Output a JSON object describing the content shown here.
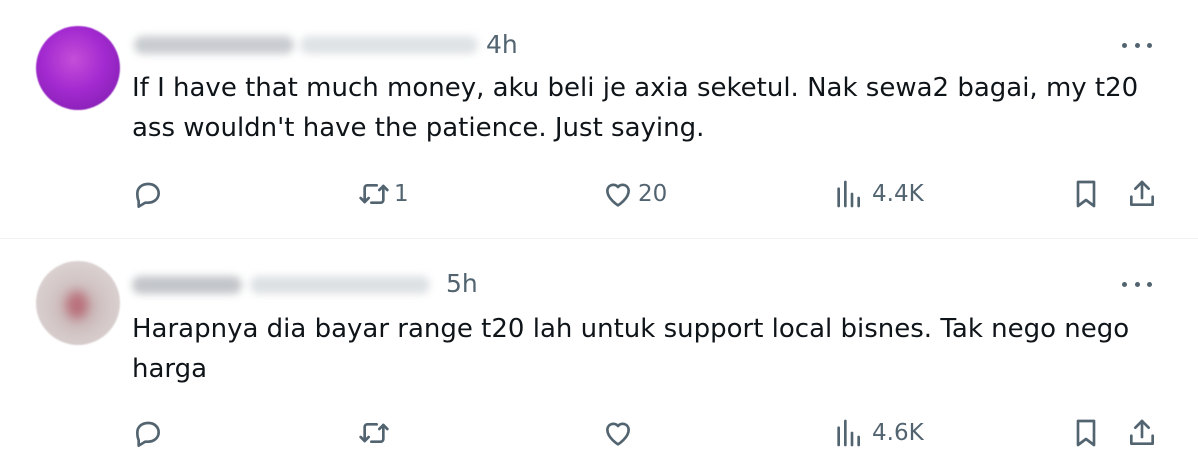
{
  "tweets": [
    {
      "time": "4h",
      "text": "If I have that much money, aku beli je axia seketul. Nak sewa2 bagai, my t20 ass wouldn't have the patience. Just saying.",
      "retweets": "1",
      "likes": "20",
      "views": "4.4K"
    },
    {
      "time": "5h",
      "text": "Harapnya dia bayar range t20 lah untuk support local bisnes. Tak nego nego harga",
      "retweets": "",
      "likes": "",
      "views": "4.6K"
    }
  ],
  "icons": {
    "reply": "reply-icon",
    "retweet": "retweet-icon",
    "like": "heart-icon",
    "views": "views-chart-icon",
    "bookmark": "bookmark-icon",
    "share": "share-icon",
    "more": "more-horizontal-icon"
  },
  "colors": {
    "text": "#0f1419",
    "secondary": "#536471",
    "divider": "#eff3f4"
  }
}
